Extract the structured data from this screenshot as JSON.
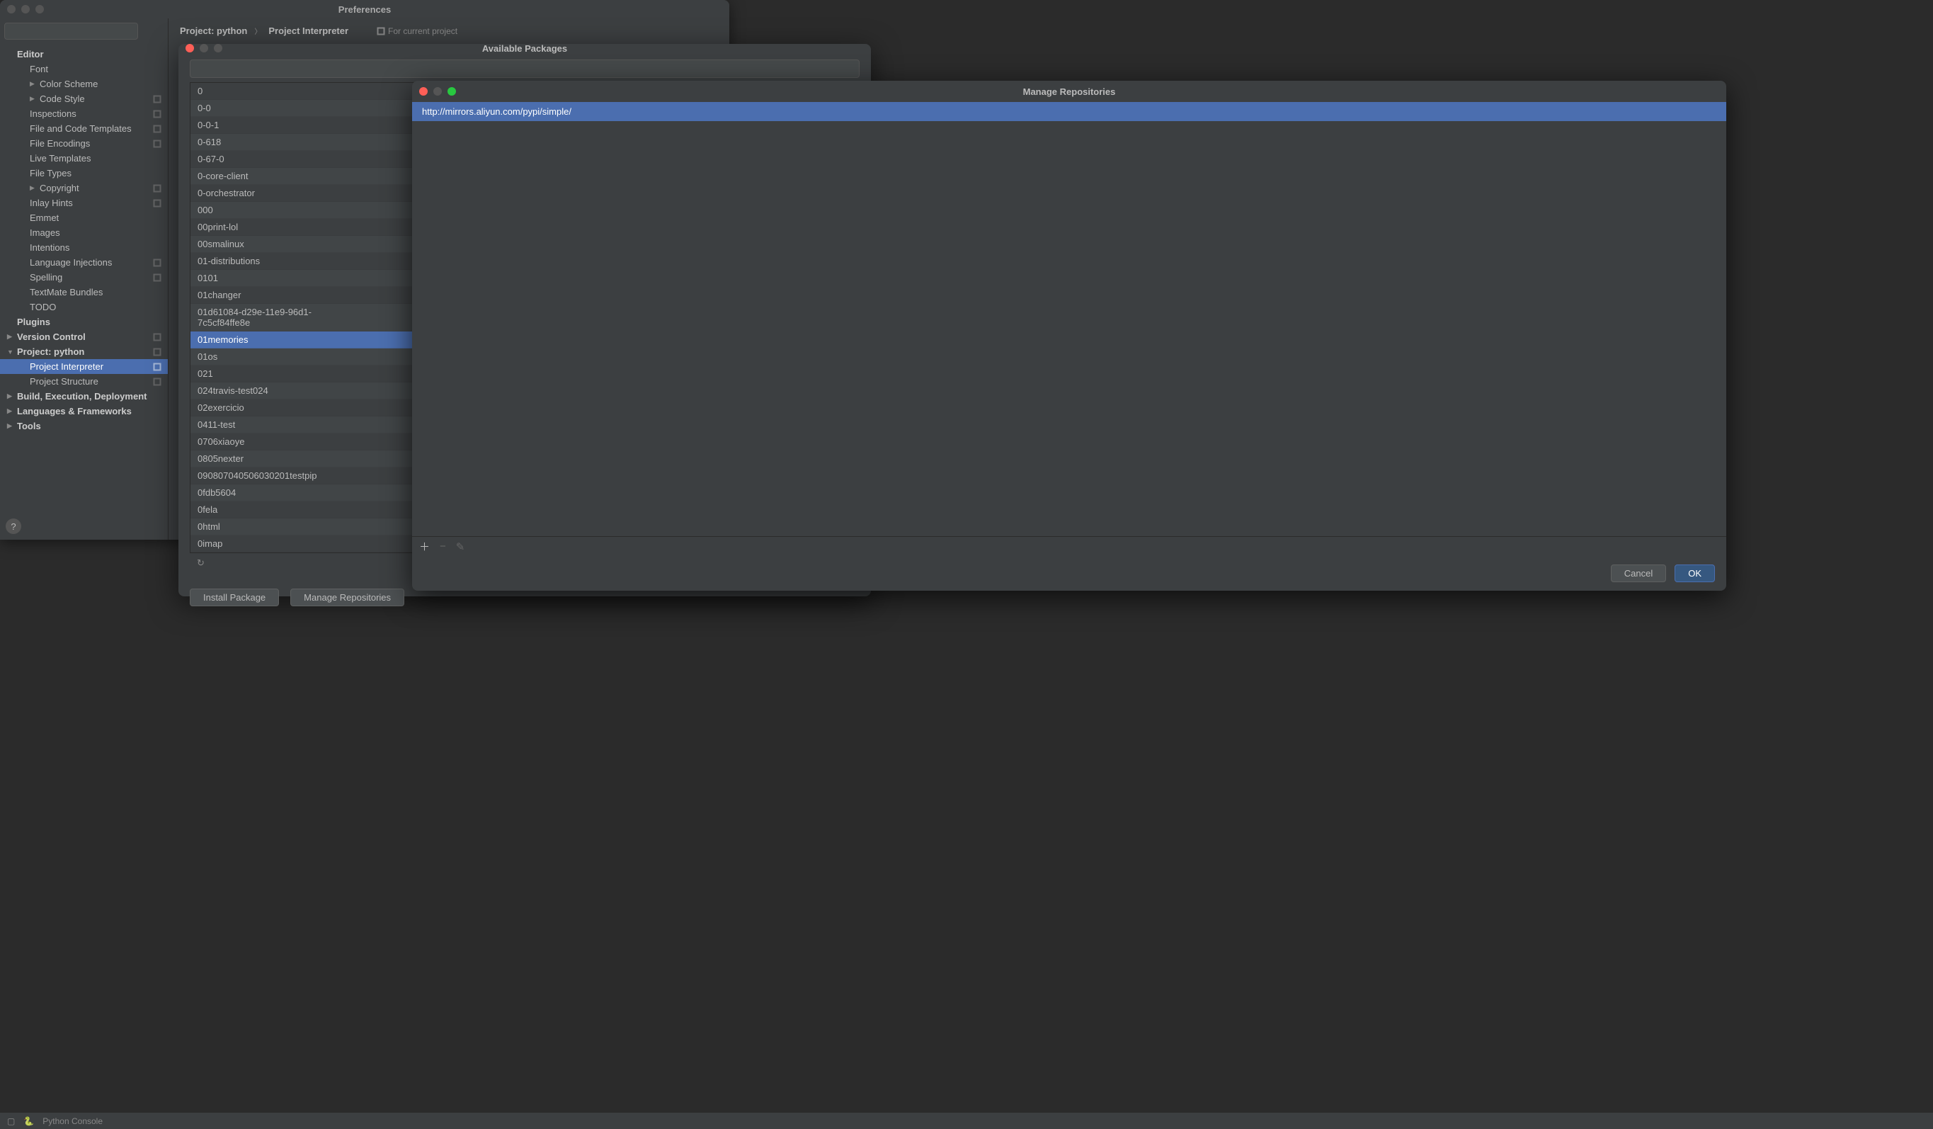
{
  "prefs": {
    "title": "Preferences",
    "search_placeholder": "",
    "breadcrumb": {
      "project": "Project: python",
      "section": "Project Interpreter",
      "for_project": "For current project"
    },
    "tree": {
      "editor": "Editor",
      "font": "Font",
      "color_scheme": "Color Scheme",
      "code_style": "Code Style",
      "inspections": "Inspections",
      "file_code_templates": "File and Code Templates",
      "file_encodings": "File Encodings",
      "live_templates": "Live Templates",
      "file_types": "File Types",
      "copyright": "Copyright",
      "inlay_hints": "Inlay Hints",
      "emmet": "Emmet",
      "images": "Images",
      "intentions": "Intentions",
      "language_injections": "Language Injections",
      "spelling": "Spelling",
      "textmate": "TextMate Bundles",
      "todo": "TODO",
      "plugins": "Plugins",
      "version_control": "Version Control",
      "project_python": "Project: python",
      "project_interpreter": "Project Interpreter",
      "project_structure": "Project Structure",
      "build": "Build, Execution, Deployment",
      "languages": "Languages & Frameworks",
      "tools": "Tools"
    }
  },
  "avail": {
    "title": "Available Packages",
    "install_label": "Install Package",
    "manage_label": "Manage Repositories",
    "source_short": "http://mirrors.aliyu",
    "source_short_trunc": "rors.aliyu",
    "packages": [
      "0",
      "0-0",
      "0-0-1",
      "0-618",
      "0-67-0",
      "0-core-client",
      "0-orchestrator",
      "000",
      "00print-lol",
      "00smalinux",
      "01-distributions",
      "0101",
      "01changer",
      "01d61084-d29e-11e9-96d1-7c5cf84ffe8e",
      "01memories",
      "01os",
      "021",
      "024travis-test024",
      "02exercicio",
      "0411-test",
      "0706xiaoye",
      "0805nexter",
      "090807040506030201testpip",
      "0fdb5604",
      "0fela",
      "0html",
      "0imap"
    ]
  },
  "repo": {
    "title": "Manage Repositories",
    "items": [
      "http://mirrors.aliyun.com/pypi/simple/"
    ],
    "cancel": "Cancel",
    "ok": "OK"
  },
  "status": {
    "python": "Python Console"
  }
}
